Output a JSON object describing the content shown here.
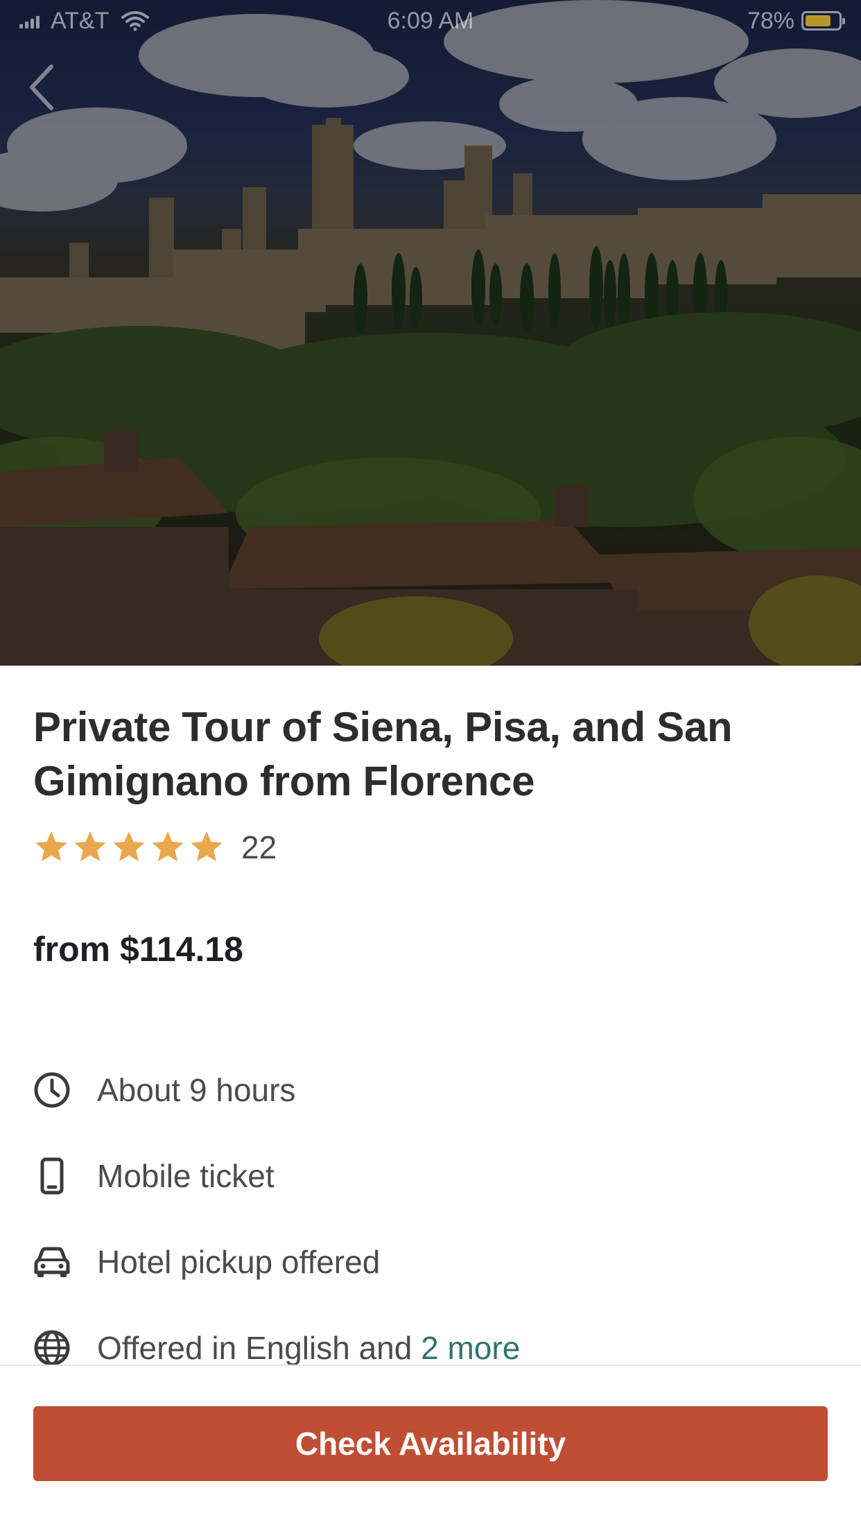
{
  "status_bar": {
    "carrier": "AT&T",
    "time": "6:09 AM",
    "battery": "78%",
    "battery_level": 0.78
  },
  "header": {
    "back_icon": "chevron-left-icon"
  },
  "hero": {
    "alt": "San Gimignano"
  },
  "product": {
    "title": "Private Tour of Siena, Pisa, and San Gimignano from Florence",
    "rating_stars": 5,
    "rating_max": 5,
    "review_count": "22",
    "price": "from $114.18"
  },
  "features": [
    {
      "icon": "clock-icon",
      "label": "About 9 hours"
    },
    {
      "icon": "mobile-phone-icon",
      "label": "Mobile ticket"
    },
    {
      "icon": "car-icon",
      "label": "Hotel pickup offered"
    },
    {
      "icon": "globe-icon",
      "label": "Offered in English and ",
      "link": "2 more"
    }
  ],
  "cta": {
    "label": "Check Availability"
  },
  "colors": {
    "star": "#e9a84e",
    "link": "#2f7470",
    "cta": "#c04e34"
  }
}
